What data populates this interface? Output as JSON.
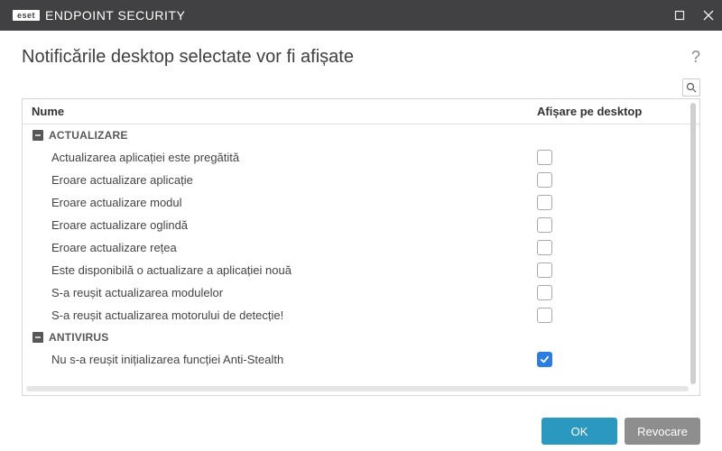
{
  "titlebar": {
    "brand_tag": "eset",
    "brand_text": "ENDPOINT SECURITY"
  },
  "heading": "Notificările desktop selectate vor fi afișate",
  "help_glyph": "?",
  "columns": {
    "name": "Nume",
    "display": "Afișare pe desktop"
  },
  "sections": [
    {
      "name": "actualizare",
      "label": "ACTUALIZARE",
      "items": [
        {
          "label": "Actualizarea aplicației este pregătită",
          "checked": false
        },
        {
          "label": "Eroare actualizare aplicație",
          "checked": false
        },
        {
          "label": "Eroare actualizare modul",
          "checked": false
        },
        {
          "label": "Eroare actualizare oglindă",
          "checked": false
        },
        {
          "label": "Eroare actualizare rețea",
          "checked": false
        },
        {
          "label": "Este disponibilă o actualizare a aplicației nouă",
          "checked": false
        },
        {
          "label": "S-a reușit actualizarea modulelor",
          "checked": false
        },
        {
          "label": "S-a reușit actualizarea motorului de detecție!",
          "checked": false
        }
      ]
    },
    {
      "name": "antivirus",
      "label": "ANTIVIRUS",
      "items": [
        {
          "label": "Nu s-a reușit inițializarea funcției Anti-Stealth",
          "checked": true
        }
      ]
    }
  ],
  "footer": {
    "ok": "OK",
    "cancel": "Revocare"
  }
}
